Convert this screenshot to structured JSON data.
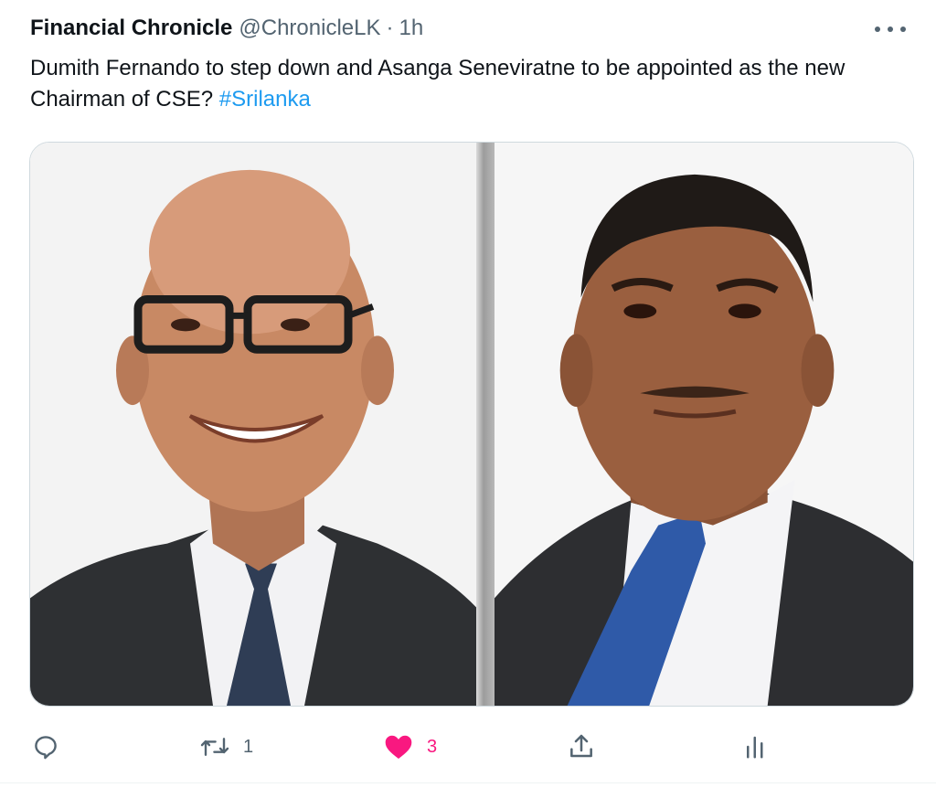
{
  "tweet": {
    "display_name": "Financial Chronicle",
    "handle": "@ChronicleLK",
    "separator": "·",
    "time": "1h",
    "text": "Dumith Fernando to step down and Asanga Seneviratne to be appointed as the new Chairman of CSE? ",
    "hashtag": "#Srilanka"
  },
  "actions": {
    "reply_icon": "reply-icon",
    "retweet_icon": "retweet-icon",
    "retweet_count": "1",
    "like_icon": "heart-icon-filled",
    "like_count": "3",
    "share_icon": "share-icon",
    "analytics_icon": "analytics-icon"
  },
  "colors": {
    "text": "#0f1419",
    "secondary": "#536471",
    "link": "#1d9bf0",
    "like": "#f91880",
    "border": "#cfd9de"
  }
}
